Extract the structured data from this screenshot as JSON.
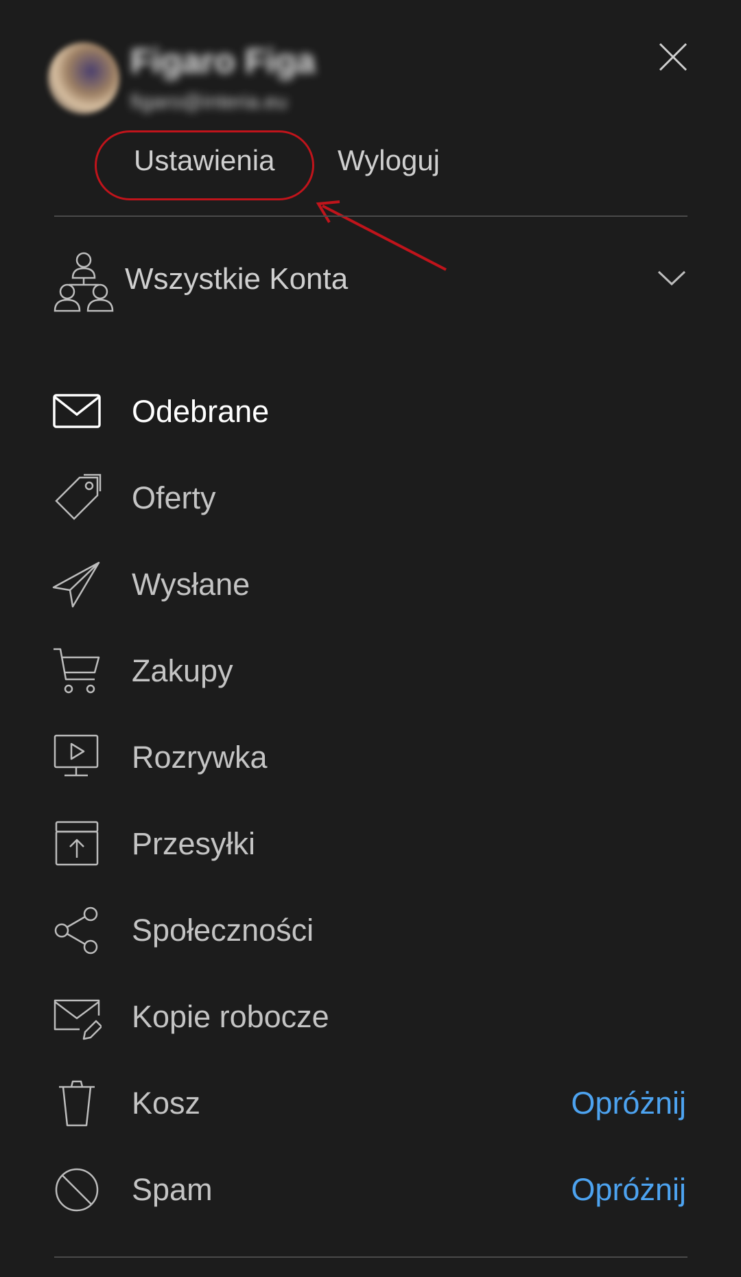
{
  "user": {
    "name": "Figaro Figa",
    "email": "figaro@interia.eu"
  },
  "header": {
    "settings_label": "Ustawienia",
    "logout_label": "Wyloguj",
    "close_icon": "close-icon"
  },
  "accounts": {
    "label": "Wszystkie Konta",
    "icon": "accounts-icon"
  },
  "folders": [
    {
      "label": "Odebrane",
      "icon": "envelope-icon",
      "active": true
    },
    {
      "label": "Oferty",
      "icon": "tag-icon"
    },
    {
      "label": "Wysłane",
      "icon": "paper-plane-icon"
    },
    {
      "label": "Zakupy",
      "icon": "cart-icon"
    },
    {
      "label": "Rozrywka",
      "icon": "play-screen-icon"
    },
    {
      "label": "Przesyłki",
      "icon": "package-icon"
    },
    {
      "label": "Społeczności",
      "icon": "share-icon"
    },
    {
      "label": "Kopie robocze",
      "icon": "draft-envelope-icon"
    },
    {
      "label": "Kosz",
      "icon": "trash-icon",
      "action": "Opróżnij"
    },
    {
      "label": "Spam",
      "icon": "blocked-icon",
      "action": "Opróżnij"
    }
  ],
  "colors": {
    "background": "#1c1c1c",
    "text": "#cfcfcf",
    "active_text": "#ffffff",
    "accent": "#4da3f0",
    "annotation": "#c0141b"
  }
}
